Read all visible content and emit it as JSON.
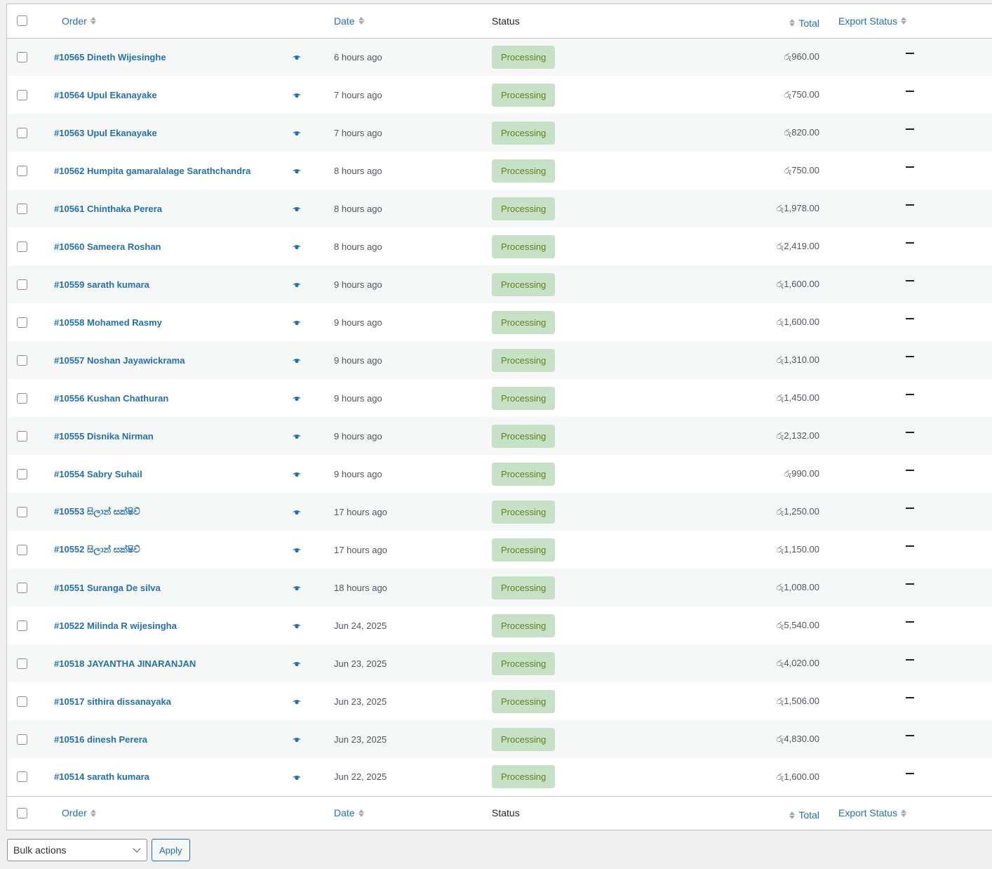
{
  "columns": {
    "order": "Order",
    "date": "Date",
    "status": "Status",
    "total": "Total",
    "export_status": "Export Status"
  },
  "orders": [
    {
      "order": "#10565 Dineth Wijesinghe",
      "date": "6 hours ago",
      "status": "Processing",
      "total": "රු960.00",
      "export_status": "–"
    },
    {
      "order": "#10564 Upul Ekanayake",
      "date": "7 hours ago",
      "status": "Processing",
      "total": "රු750.00",
      "export_status": "–"
    },
    {
      "order": "#10563 Upul Ekanayake",
      "date": "7 hours ago",
      "status": "Processing",
      "total": "රු820.00",
      "export_status": "–"
    },
    {
      "order": "#10562 Humpita gamaralalage Sarathchandra",
      "date": "8 hours ago",
      "status": "Processing",
      "total": "රු750.00",
      "export_status": "–"
    },
    {
      "order": "#10561 Chinthaka Perera",
      "date": "8 hours ago",
      "status": "Processing",
      "total": "රු1,978.00",
      "export_status": "–"
    },
    {
      "order": "#10560 Sameera Roshan",
      "date": "8 hours ago",
      "status": "Processing",
      "total": "රු2,419.00",
      "export_status": "–"
    },
    {
      "order": "#10559 sarath kumara",
      "date": "9 hours ago",
      "status": "Processing",
      "total": "රු1,600.00",
      "export_status": "–"
    },
    {
      "order": "#10558 Mohamed Rasmy",
      "date": "9 hours ago",
      "status": "Processing",
      "total": "රු1,600.00",
      "export_status": "–"
    },
    {
      "order": "#10557 Noshan Jayawickrama",
      "date": "9 hours ago",
      "status": "Processing",
      "total": "රු1,310.00",
      "export_status": "–"
    },
    {
      "order": "#10556 Kushan Chathuran",
      "date": "9 hours ago",
      "status": "Processing",
      "total": "රු1,450.00",
      "export_status": "–"
    },
    {
      "order": "#10555 Disnika Nirman",
      "date": "9 hours ago",
      "status": "Processing",
      "total": "රු2,132.00",
      "export_status": "–"
    },
    {
      "order": "#10554 Sabry Suhail",
      "date": "9 hours ago",
      "status": "Processing",
      "total": "රු990.00",
      "export_status": "–"
    },
    {
      "order": "#10553 සිලාන් සක්ෂිව්",
      "date": "17 hours ago",
      "status": "Processing",
      "total": "රු1,250.00",
      "export_status": "–"
    },
    {
      "order": "#10552 සිලාන් සක්ෂිව්",
      "date": "17 hours ago",
      "status": "Processing",
      "total": "රු1,150.00",
      "export_status": "–"
    },
    {
      "order": "#10551 Suranga De silva",
      "date": "18 hours ago",
      "status": "Processing",
      "total": "රු1,008.00",
      "export_status": "–"
    },
    {
      "order": "#10522 Milinda R wijesingha",
      "date": "Jun 24, 2025",
      "status": "Processing",
      "total": "රු5,540.00",
      "export_status": "–"
    },
    {
      "order": "#10518 JAYANTHA JINARANJAN",
      "date": "Jun 23, 2025",
      "status": "Processing",
      "total": "රු4,020.00",
      "export_status": "–"
    },
    {
      "order": "#10517 sithira dissanayaka",
      "date": "Jun 23, 2025",
      "status": "Processing",
      "total": "රු1,506.00",
      "export_status": "–"
    },
    {
      "order": "#10516 dinesh Perera",
      "date": "Jun 23, 2025",
      "status": "Processing",
      "total": "රු4,830.00",
      "export_status": "–"
    },
    {
      "order": "#10514 sarath kumara",
      "date": "Jun 22, 2025",
      "status": "Processing",
      "total": "රු1,600.00",
      "export_status": "–"
    }
  ],
  "bulk": {
    "selected": "Bulk actions",
    "apply_label": "Apply"
  },
  "colors": {
    "link": "#2271b1",
    "status_processing_bg": "#c6e1c6",
    "status_processing_text": "#5b841b"
  }
}
